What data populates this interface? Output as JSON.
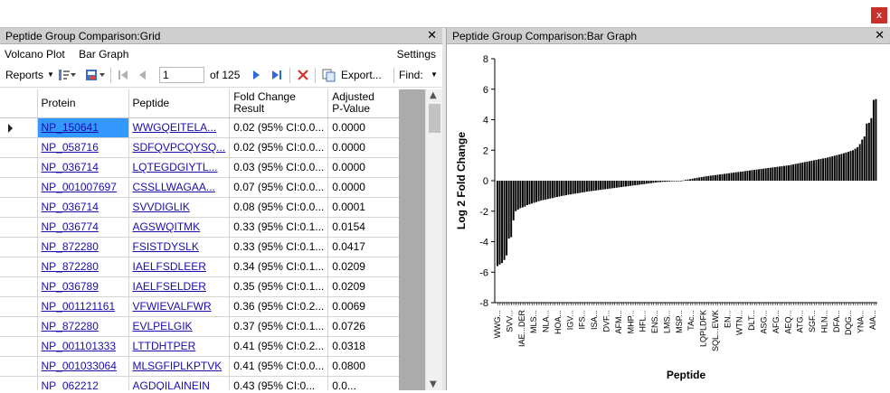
{
  "window": {
    "close_label": "x"
  },
  "grid_pane": {
    "title": "Peptide Group Comparison:Grid",
    "close_label": "✕",
    "menu": {
      "volcano": "Volcano Plot",
      "bar": "Bar Graph",
      "settings": "Settings"
    },
    "toolbar": {
      "reports": "Reports",
      "page_value": "1",
      "page_of": "of 125",
      "export": "Export...",
      "find": "Find:"
    },
    "columns": [
      "Protein",
      "Peptide",
      "Fold Change Result",
      "Adjusted P-Value"
    ],
    "columns_display": [
      [
        "Protein"
      ],
      [
        "Peptide"
      ],
      [
        "Fold Change",
        "Result"
      ],
      [
        "Adjusted",
        "P-Value"
      ]
    ],
    "rows": [
      {
        "protein": "NP_150641",
        "peptide": "WWGQEITELA...",
        "fold": "0.02 (95% CI:0.0...",
        "p": "0.0000"
      },
      {
        "protein": "NP_058716",
        "peptide": "SDFQVPCQYSQ...",
        "fold": "0.02 (95% CI:0.0...",
        "p": "0.0000"
      },
      {
        "protein": "NP_036714",
        "peptide": "LQTEGDGIYTL...",
        "fold": "0.03 (95% CI:0.0...",
        "p": "0.0000"
      },
      {
        "protein": "NP_001007697",
        "peptide": "CSSLLWAGAA...",
        "fold": "0.07 (95% CI:0.0...",
        "p": "0.0000"
      },
      {
        "protein": "NP_036714",
        "peptide": "SVVDIGLIK",
        "fold": "0.08 (95% CI:0.0...",
        "p": "0.0001"
      },
      {
        "protein": "NP_036774",
        "peptide": "AGSWQITMK",
        "fold": "0.33 (95% CI:0.1...",
        "p": "0.0154"
      },
      {
        "protein": "NP_872280",
        "peptide": "FSISTDYSLK",
        "fold": "0.33 (95% CI:0.1...",
        "p": "0.0417"
      },
      {
        "protein": "NP_872280",
        "peptide": "IAELFSDLEER",
        "fold": "0.34 (95% CI:0.1...",
        "p": "0.0209"
      },
      {
        "protein": "NP_036789",
        "peptide": "IAELFSELDER",
        "fold": "0.35 (95% CI:0.1...",
        "p": "0.0209"
      },
      {
        "protein": "NP_001121161",
        "peptide": "VFWIEVALFWR",
        "fold": "0.36 (95% CI:0.2...",
        "p": "0.0069"
      },
      {
        "protein": "NP_872280",
        "peptide": "EVLPELGIK",
        "fold": "0.37 (95% CI:0.1...",
        "p": "0.0726"
      },
      {
        "protein": "NP_001101333",
        "peptide": "LTTDHTPER",
        "fold": "0.41 (95% CI:0.2...",
        "p": "0.0318"
      },
      {
        "protein": "NP_001033064",
        "peptide": "MLSGFIPLKPTVK",
        "fold": "0.41 (95% CI:0.0...",
        "p": "0.0800"
      },
      {
        "protein": "NP_062212",
        "peptide": "AGDQILAINEIN",
        "fold": "0.43 (95% CI:0...",
        "p": "0.0..."
      }
    ]
  },
  "chart_pane": {
    "title": "Peptide Group Comparison:Bar Graph",
    "close_label": "✕"
  },
  "chart_data": {
    "type": "bar",
    "title": "",
    "xlabel": "Peptide",
    "ylabel": "Log 2 Fold Change",
    "ylim": [
      -8,
      8
    ],
    "yticks": [
      -8,
      -6,
      -4,
      -2,
      0,
      2,
      4,
      6,
      8
    ],
    "grid": false,
    "bar_color": "#000000",
    "xtick_labels": [
      "WWG...",
      "SVV...",
      "IAE...DER",
      "MLS...",
      "NLA...",
      "HOA...",
      "IGV...",
      "IFS...",
      "ISA...",
      "DVF...",
      "AFM...",
      "MHP...",
      "HFL...",
      "ENS...",
      "LMS...",
      "MSP...",
      "TAc...",
      "LQPLDFK",
      "SQL...EWK",
      "EN...",
      "WTN...",
      "DLT...",
      "ASG...",
      "AFG...",
      "AEQ...",
      "ATG...",
      "SGF...",
      "HLN...",
      "DFA...",
      "DQG...",
      "YNA...",
      "AIA..."
    ],
    "values": [
      -5.6,
      -5.5,
      -5.4,
      -5.2,
      -4.9,
      -3.8,
      -3.7,
      -2.6,
      -2.0,
      -1.9,
      -1.8,
      -1.75,
      -1.7,
      -1.6,
      -1.55,
      -1.5,
      -1.45,
      -1.4,
      -1.35,
      -1.3,
      -1.27,
      -1.24,
      -1.2,
      -1.17,
      -1.14,
      -1.1,
      -1.07,
      -1.04,
      -1.0,
      -0.98,
      -0.95,
      -0.92,
      -0.9,
      -0.87,
      -0.85,
      -0.82,
      -0.8,
      -0.77,
      -0.75,
      -0.72,
      -0.7,
      -0.68,
      -0.66,
      -0.64,
      -0.62,
      -0.6,
      -0.58,
      -0.56,
      -0.54,
      -0.52,
      -0.5,
      -0.48,
      -0.46,
      -0.44,
      -0.42,
      -0.4,
      -0.38,
      -0.36,
      -0.34,
      -0.32,
      -0.3,
      -0.28,
      -0.26,
      -0.24,
      -0.22,
      -0.2,
      -0.18,
      -0.16,
      -0.14,
      -0.12,
      -0.1,
      -0.09,
      -0.08,
      -0.07,
      -0.06,
      -0.05,
      -0.04,
      -0.03,
      -0.02,
      -0.01,
      0.0,
      0.02,
      0.05,
      0.08,
      0.1,
      0.13,
      0.16,
      0.19,
      0.21,
      0.24,
      0.26,
      0.29,
      0.31,
      0.33,
      0.35,
      0.37,
      0.39,
      0.41,
      0.43,
      0.45,
      0.47,
      0.49,
      0.51,
      0.53,
      0.55,
      0.57,
      0.59,
      0.61,
      0.63,
      0.65,
      0.67,
      0.69,
      0.71,
      0.73,
      0.75,
      0.77,
      0.79,
      0.81,
      0.83,
      0.85,
      0.87,
      0.89,
      0.91,
      0.93,
      0.95,
      0.97,
      0.99,
      1.01,
      1.04,
      1.07,
      1.1,
      1.13,
      1.16,
      1.19,
      1.22,
      1.25,
      1.28,
      1.31,
      1.34,
      1.37,
      1.4,
      1.43,
      1.46,
      1.49,
      1.52,
      1.56,
      1.6,
      1.64,
      1.68,
      1.72,
      1.76,
      1.8,
      1.85,
      1.9,
      1.95,
      2.0,
      2.1,
      2.2,
      2.4,
      2.7,
      2.9,
      3.75,
      3.8,
      4.1,
      5.3,
      5.35
    ]
  }
}
